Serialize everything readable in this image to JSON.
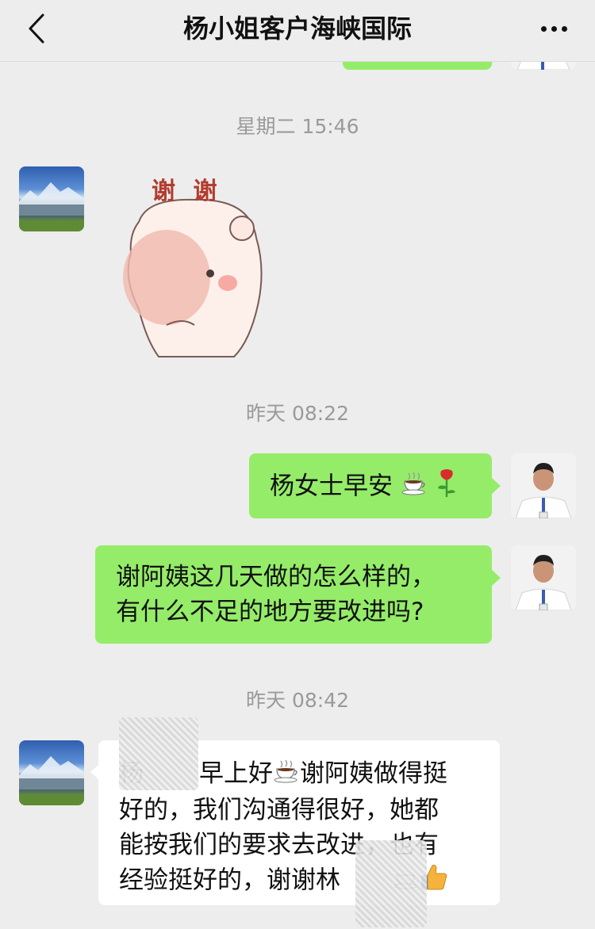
{
  "header": {
    "title": "杨小姐客户海峡国际"
  },
  "messages": {
    "ts1": "星期二 15:46",
    "sticker_text": "谢 谢",
    "ts2": "昨天 08:22",
    "m1": "杨女士早安",
    "m2_line1": "谢阿姨这几天做的怎么样的，",
    "m2_line2": "有什么不足的地方要改进吗?",
    "ts3": "昨天 08:42",
    "m3_line1_a": "杨",
    "m3_line1_b": "早上好",
    "m3_line1_c": "谢阿姨做得挺",
    "m3_line2": "好的，我们沟通得很好，她都",
    "m3_line3": "能按我们的要求去改进，也有",
    "m3_line4": "经验挺好的，谢谢林"
  },
  "icons": {
    "back": "chevron-left-icon",
    "more": "more-dots-icon",
    "coffee": "coffee-emoji",
    "rose": "rose-emoji",
    "thumbs": "thumbs-up-emoji"
  }
}
